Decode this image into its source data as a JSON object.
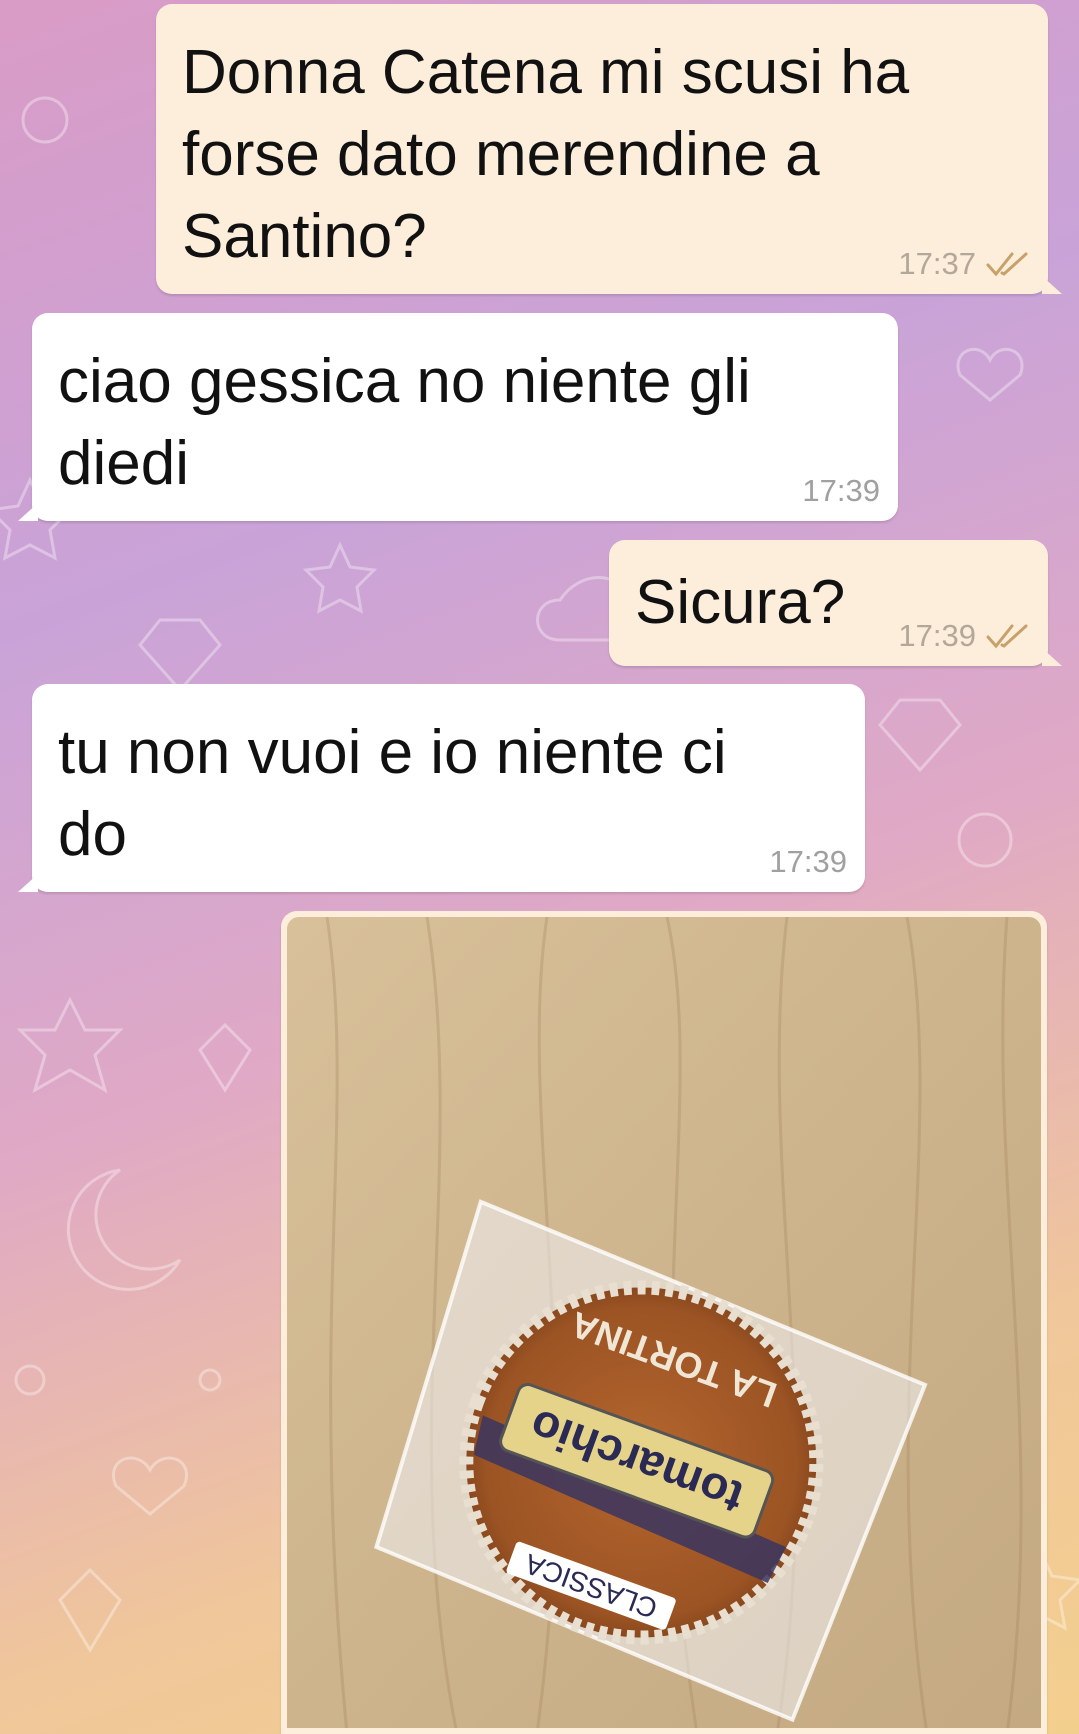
{
  "messages": [
    {
      "direction": "outgoing",
      "text": "Donna Catena mi scusi ha\nforse dato merendine a\nSantino?",
      "time": "17:37",
      "status": "read-double-check-icon"
    },
    {
      "direction": "incoming",
      "text": "ciao gessica no niente gli\ndiedi",
      "time": "17:39"
    },
    {
      "direction": "outgoing",
      "text": "Sicura?",
      "time": "17:39",
      "status": "read-double-check-icon"
    },
    {
      "direction": "incoming",
      "text": "tu non vuoi e io niente ci\ndo",
      "time": "17:39"
    }
  ],
  "photo": {
    "subject": "packaged-snack-cake",
    "brand_text": "tomarchio",
    "variant_text": "CLASSICA",
    "product_text": "LA TORTINA"
  },
  "colors": {
    "outgoing_bubble": "#fceedb",
    "incoming_bubble": "#ffffff",
    "check_marks": "#c8a06a",
    "background_top": "#d99cc6",
    "background_bottom": "#f3cf8e"
  }
}
